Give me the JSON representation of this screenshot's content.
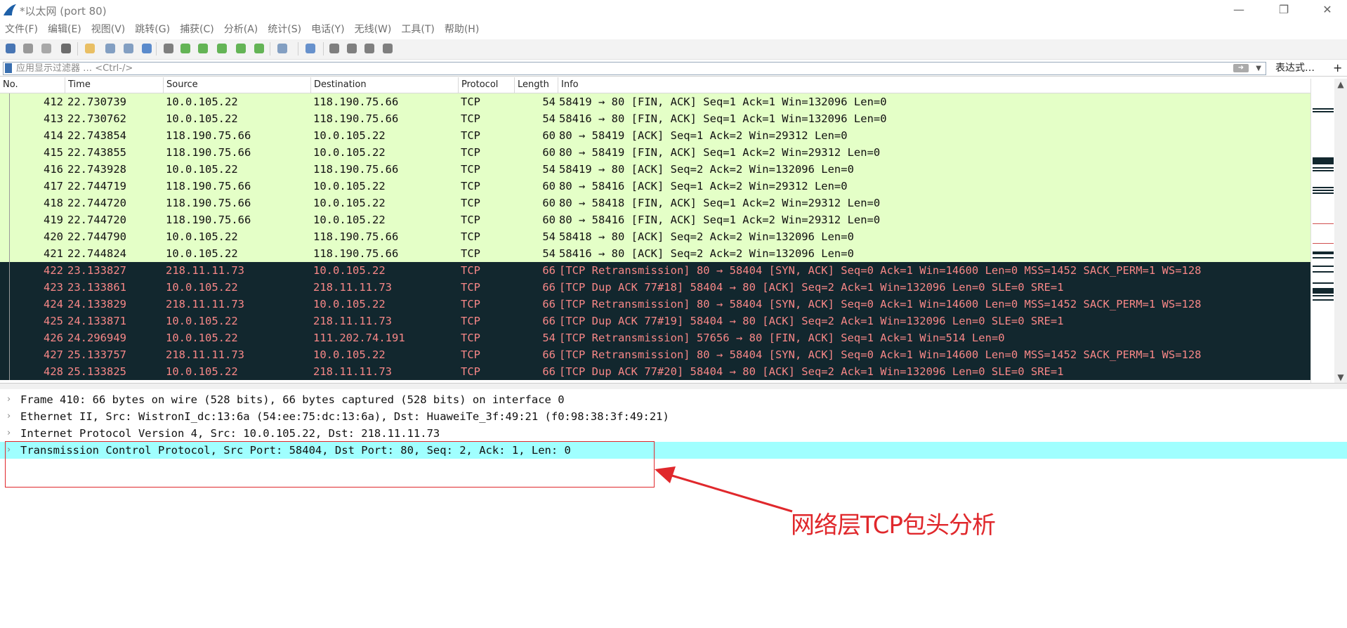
{
  "window": {
    "title": "*以太网 (port 80)",
    "controls": {
      "minimize": "—",
      "maximize": "❐",
      "close": "✕"
    }
  },
  "menu": [
    {
      "label": "文件(F)"
    },
    {
      "label": "编辑(E)"
    },
    {
      "label": "视图(V)"
    },
    {
      "label": "跳转(G)"
    },
    {
      "label": "捕获(C)"
    },
    {
      "label": "分析(A)"
    },
    {
      "label": "统计(S)"
    },
    {
      "label": "电话(Y)"
    },
    {
      "label": "无线(W)"
    },
    {
      "label": "工具(T)"
    },
    {
      "label": "帮助(H)"
    }
  ],
  "toolbar": [
    {
      "name": "start-capture-icon",
      "color": "#2a5fa8"
    },
    {
      "name": "stop-capture-icon",
      "color": "#888888"
    },
    {
      "name": "restart-capture-icon",
      "color": "#9a9a9a"
    },
    {
      "name": "capture-options-icon",
      "color": "#555555"
    },
    {
      "name": "open-file-icon",
      "color": "#e6b54a"
    },
    {
      "name": "save-file-icon",
      "color": "#6f8fb8"
    },
    {
      "name": "close-file-icon",
      "color": "#6f8fb8"
    },
    {
      "name": "reload-file-icon",
      "color": "#3f78c4"
    },
    {
      "name": "find-packet-icon",
      "color": "#6a6a6a"
    },
    {
      "name": "go-back-icon",
      "color": "#4aa83a"
    },
    {
      "name": "go-forward-icon",
      "color": "#4aa83a"
    },
    {
      "name": "go-to-packet-icon",
      "color": "#4aa83a"
    },
    {
      "name": "go-first-icon",
      "color": "#4aa83a"
    },
    {
      "name": "go-last-icon",
      "color": "#4aa83a"
    },
    {
      "name": "autoscroll-icon",
      "color": "#6f8fb8"
    },
    {
      "name": "colorize-icon",
      "color": "#4e7fc4"
    },
    {
      "name": "zoom-in-icon",
      "color": "#6a6a6a"
    },
    {
      "name": "zoom-out-icon",
      "color": "#6a6a6a"
    },
    {
      "name": "zoom-normal-icon",
      "color": "#6a6a6a"
    },
    {
      "name": "resize-columns-icon",
      "color": "#6a6a6a"
    }
  ],
  "filter": {
    "placeholder": "应用显示过滤器 … <Ctrl-/>",
    "expression_label": "表达式…",
    "add_label": "+"
  },
  "columns": {
    "no": "No.",
    "time": "Time",
    "source": "Source",
    "destination": "Destination",
    "protocol": "Protocol",
    "length": "Length",
    "info": "Info"
  },
  "colors": {
    "row_green_bg": "#e4ffc7",
    "row_dark_bg": "#12272e",
    "row_dark_fg": "#f78787",
    "selected_detail_bg": "#a0ffff",
    "annotation": "#e0282c"
  },
  "packets": [
    {
      "no": "412",
      "time": "22.730739",
      "source": "10.0.105.22",
      "destination": "118.190.75.66",
      "protocol": "TCP",
      "length": "54",
      "info": "58419 → 80 [FIN, ACK] Seq=1 Ack=1 Win=132096 Len=0",
      "style": "green"
    },
    {
      "no": "413",
      "time": "22.730762",
      "source": "10.0.105.22",
      "destination": "118.190.75.66",
      "protocol": "TCP",
      "length": "54",
      "info": "58416 → 80 [FIN, ACK] Seq=1 Ack=1 Win=132096 Len=0",
      "style": "green"
    },
    {
      "no": "414",
      "time": "22.743854",
      "source": "118.190.75.66",
      "destination": "10.0.105.22",
      "protocol": "TCP",
      "length": "60",
      "info": "80 → 58419 [ACK] Seq=1 Ack=2 Win=29312 Len=0",
      "style": "green"
    },
    {
      "no": "415",
      "time": "22.743855",
      "source": "118.190.75.66",
      "destination": "10.0.105.22",
      "protocol": "TCP",
      "length": "60",
      "info": "80 → 58419 [FIN, ACK] Seq=1 Ack=2 Win=29312 Len=0",
      "style": "green"
    },
    {
      "no": "416",
      "time": "22.743928",
      "source": "10.0.105.22",
      "destination": "118.190.75.66",
      "protocol": "TCP",
      "length": "54",
      "info": "58419 → 80 [ACK] Seq=2 Ack=2 Win=132096 Len=0",
      "style": "green"
    },
    {
      "no": "417",
      "time": "22.744719",
      "source": "118.190.75.66",
      "destination": "10.0.105.22",
      "protocol": "TCP",
      "length": "60",
      "info": "80 → 58416 [ACK] Seq=1 Ack=2 Win=29312 Len=0",
      "style": "green"
    },
    {
      "no": "418",
      "time": "22.744720",
      "source": "118.190.75.66",
      "destination": "10.0.105.22",
      "protocol": "TCP",
      "length": "60",
      "info": "80 → 58418 [FIN, ACK] Seq=1 Ack=2 Win=29312 Len=0",
      "style": "green"
    },
    {
      "no": "419",
      "time": "22.744720",
      "source": "118.190.75.66",
      "destination": "10.0.105.22",
      "protocol": "TCP",
      "length": "60",
      "info": "80 → 58416 [FIN, ACK] Seq=1 Ack=2 Win=29312 Len=0",
      "style": "green"
    },
    {
      "no": "420",
      "time": "22.744790",
      "source": "10.0.105.22",
      "destination": "118.190.75.66",
      "protocol": "TCP",
      "length": "54",
      "info": "58418 → 80 [ACK] Seq=2 Ack=2 Win=132096 Len=0",
      "style": "green"
    },
    {
      "no": "421",
      "time": "22.744824",
      "source": "10.0.105.22",
      "destination": "118.190.75.66",
      "protocol": "TCP",
      "length": "54",
      "info": "58416 → 80 [ACK] Seq=2 Ack=2 Win=132096 Len=0",
      "style": "green"
    },
    {
      "no": "422",
      "time": "23.133827",
      "source": "218.11.11.73",
      "destination": "10.0.105.22",
      "protocol": "TCP",
      "length": "66",
      "info": "[TCP Retransmission] 80 → 58404 [SYN, ACK] Seq=0 Ack=1 Win=14600 Len=0 MSS=1452 SACK_PERM=1 WS=128",
      "style": "dark"
    },
    {
      "no": "423",
      "time": "23.133861",
      "source": "10.0.105.22",
      "destination": "218.11.11.73",
      "protocol": "TCP",
      "length": "66",
      "info": "[TCP Dup ACK 77#18] 58404 → 80 [ACK] Seq=2 Ack=1 Win=132096 Len=0 SLE=0 SRE=1",
      "style": "dark"
    },
    {
      "no": "424",
      "time": "24.133829",
      "source": "218.11.11.73",
      "destination": "10.0.105.22",
      "protocol": "TCP",
      "length": "66",
      "info": "[TCP Retransmission] 80 → 58404 [SYN, ACK] Seq=0 Ack=1 Win=14600 Len=0 MSS=1452 SACK_PERM=1 WS=128",
      "style": "dark"
    },
    {
      "no": "425",
      "time": "24.133871",
      "source": "10.0.105.22",
      "destination": "218.11.11.73",
      "protocol": "TCP",
      "length": "66",
      "info": "[TCP Dup ACK 77#19] 58404 → 80 [ACK] Seq=2 Ack=1 Win=132096 Len=0 SLE=0 SRE=1",
      "style": "dark"
    },
    {
      "no": "426",
      "time": "24.296949",
      "source": "10.0.105.22",
      "destination": "111.202.74.191",
      "protocol": "TCP",
      "length": "54",
      "info": "[TCP Retransmission] 57656 → 80 [FIN, ACK] Seq=1 Ack=1 Win=514 Len=0",
      "style": "dark"
    },
    {
      "no": "427",
      "time": "25.133757",
      "source": "218.11.11.73",
      "destination": "10.0.105.22",
      "protocol": "TCP",
      "length": "66",
      "info": "[TCP Retransmission] 80 → 58404 [SYN, ACK] Seq=0 Ack=1 Win=14600 Len=0 MSS=1452 SACK_PERM=1 WS=128",
      "style": "dark"
    },
    {
      "no": "428",
      "time": "25.133825",
      "source": "10.0.105.22",
      "destination": "218.11.11.73",
      "protocol": "TCP",
      "length": "66",
      "info": "[TCP Dup ACK 77#20] 58404 → 80 [ACK] Seq=2 Ack=1 Win=132096 Len=0 SLE=0 SRE=1",
      "style": "dark"
    }
  ],
  "details": [
    {
      "text": "Frame 410: 66 bytes on wire (528 bits), 66 bytes captured (528 bits) on interface 0",
      "selected": false
    },
    {
      "text": "Ethernet II, Src: WistronI_dc:13:6a (54:ee:75:dc:13:6a), Dst: HuaweiTe_3f:49:21 (f0:98:38:3f:49:21)",
      "selected": false
    },
    {
      "text": "Internet Protocol Version 4, Src: 10.0.105.22, Dst: 218.11.11.73",
      "selected": false
    },
    {
      "text": "Transmission Control Protocol, Src Port: 58404, Dst Port: 80, Seq: 2, Ack: 1, Len: 0",
      "selected": true
    }
  ],
  "annotation": {
    "label": "网络层TCP包头分析"
  }
}
